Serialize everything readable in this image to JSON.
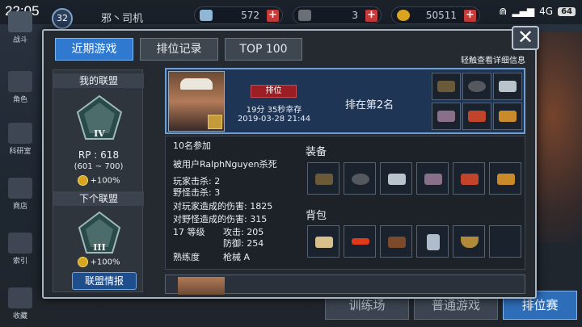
{
  "status_bar": {
    "time": "22:05",
    "network": "4G",
    "battery": "64"
  },
  "top_bar": {
    "level": "32",
    "player_name": "邪丶司机",
    "resources": [
      {
        "name": "crystal",
        "value": "572"
      },
      {
        "name": "ore",
        "value": "3"
      },
      {
        "name": "gold",
        "value": "50511"
      }
    ]
  },
  "left_nav": [
    {
      "label": "战斗",
      "icon": "sword-icon"
    },
    {
      "label": "角色",
      "icon": "character-icon"
    },
    {
      "label": "科研室",
      "icon": "flask-icon"
    },
    {
      "label": "商店",
      "icon": "cart-icon"
    },
    {
      "label": "索引",
      "icon": "books-icon"
    },
    {
      "label": "收藏",
      "icon": "book-icon"
    }
  ],
  "bottom_buttons": [
    "训练场",
    "普通游戏",
    "排位赛"
  ],
  "modal": {
    "tabs": [
      "近期游戏",
      "排位记录",
      "TOP 100"
    ],
    "hint": "轻触查看详细信息",
    "close": "✕"
  },
  "league": {
    "title": "我的联盟",
    "tier": "IV",
    "rp": "RP : 618",
    "rp_range": "(601 ~ 700)",
    "bonus": "+100%",
    "next_title": "下个联盟",
    "next_tier": "III",
    "next_bonus": "+100%",
    "info_button": "联盟情报"
  },
  "match": {
    "mode": "排位",
    "duration": "19分 35秒幸存",
    "datetime": "2019-03-28 21:44",
    "rank": "排在第2名",
    "participants": "10名参加",
    "killed_by": "被用户RalphNguyen杀死",
    "player_kills": "玩家击杀: 2",
    "monster_kills": "野怪击杀: 3",
    "player_damage": "对玩家造成的伤害: 1825",
    "monster_damage": "对野怪造成的伤害: 315",
    "level": "17 等级",
    "attack": "攻击: 205",
    "defense": "防御: 254",
    "proficiency_label": "熟练度",
    "proficiency_value": "枪械 A",
    "equipment_label": "装备",
    "backpack_label": "背包",
    "equipment": [
      "rifle-icon",
      "helmet-icon",
      "armor-icon",
      "gauntlet-icon",
      "boots-icon",
      "accessory-icon"
    ],
    "backpack": [
      "bread-icon",
      "bullet-icon",
      "crossbow-icon",
      "canister-icon",
      "bowl-icon",
      "empty-slot"
    ]
  },
  "colors": {
    "accent_blue": "#2f79d0",
    "card_blue": "#1f3555",
    "rank_badge": "#9a1e24",
    "plus_red": "#c73a3a"
  }
}
